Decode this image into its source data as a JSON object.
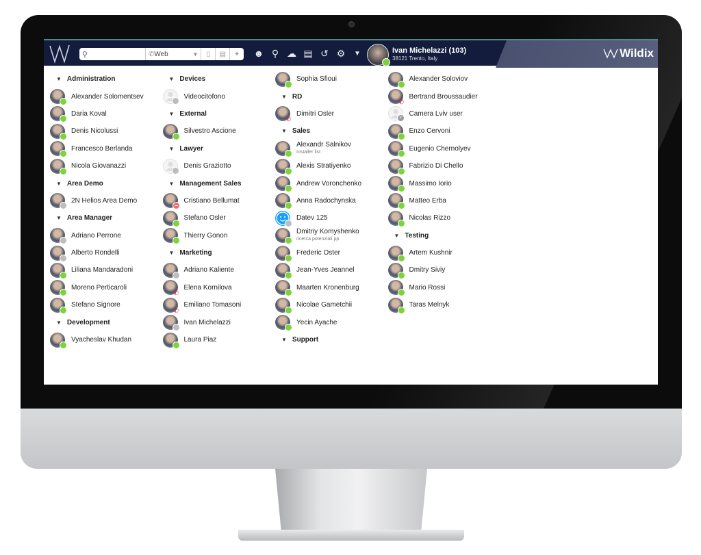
{
  "header": {
    "search_placeholder": "",
    "call_mode": "Web",
    "user_name": "Ivan Michelazzi (103)",
    "user_location": "38121 Trento, Italy",
    "user_status": "online",
    "brand": "Wildix",
    "toolbar_icons": [
      "users-icon",
      "location-pin-icon",
      "chat-icon",
      "phonebook-icon",
      "history-icon",
      "settings-icon",
      "chevron-down-icon"
    ]
  },
  "colors": {
    "header_bg": "#131c3d",
    "online": "#7ed23b",
    "offline": "#bdbdbd",
    "dnd": "#f06a6a",
    "call": "#e02020"
  },
  "columns": [
    [
      {
        "type": "group",
        "label": "Administration"
      },
      {
        "type": "contact",
        "label": "Alexander Solomentsev",
        "status": "online"
      },
      {
        "type": "contact",
        "label": "Daria Koval",
        "status": "online"
      },
      {
        "type": "contact",
        "label": "Denis Nicolussi",
        "status": "online"
      },
      {
        "type": "contact",
        "label": "Francesco Berlanda",
        "status": "online"
      },
      {
        "type": "contact",
        "label": "Nicola Giovanazzi",
        "status": "online"
      },
      {
        "type": "group",
        "label": "Area Demo"
      },
      {
        "type": "contact",
        "label": "2N Helios Area Demo",
        "status": "offline"
      },
      {
        "type": "group",
        "label": "Area Manager"
      },
      {
        "type": "contact",
        "label": "Adriano Perrone",
        "status": "offline"
      },
      {
        "type": "contact",
        "label": "Alberto Rondelli",
        "status": "offline"
      },
      {
        "type": "contact",
        "label": "Liliana Mandaradoni",
        "status": "online"
      },
      {
        "type": "contact",
        "label": "Moreno Perticaroli",
        "status": "online"
      },
      {
        "type": "contact",
        "label": "Stefano Signore",
        "status": "online"
      },
      {
        "type": "group",
        "label": "Development"
      },
      {
        "type": "contact",
        "label": "Vyacheslav Khudan",
        "status": "online"
      }
    ],
    [
      {
        "type": "group",
        "label": "Devices"
      },
      {
        "type": "contact",
        "label": "Videocitofono",
        "status": "offline",
        "avatar": "blank"
      },
      {
        "type": "group",
        "label": "External"
      },
      {
        "type": "contact",
        "label": "Silvestro Ascione",
        "status": "online"
      },
      {
        "type": "group",
        "label": "Lawyer"
      },
      {
        "type": "contact",
        "label": "Denis Graziotto",
        "status": "offline",
        "avatar": "blank"
      },
      {
        "type": "group",
        "label": "Management Sales"
      },
      {
        "type": "contact",
        "label": "Cristiano Bellumat",
        "status": "dnd"
      },
      {
        "type": "contact",
        "label": "Stefano Osler",
        "status": "online"
      },
      {
        "type": "contact",
        "label": "Thierry Gonon",
        "status": "online"
      },
      {
        "type": "group",
        "label": "Marketing"
      },
      {
        "type": "contact",
        "label": "Adriano Kaliente",
        "status": "offline"
      },
      {
        "type": "contact",
        "label": "Elena Kornilova",
        "status": "call"
      },
      {
        "type": "contact",
        "label": "Emiliano Tomasoni",
        "status": "call"
      },
      {
        "type": "contact",
        "label": "Ivan Michelazzi",
        "status": "offline"
      },
      {
        "type": "contact",
        "label": "Laura Piaz",
        "status": "online"
      }
    ],
    [
      {
        "type": "contact",
        "label": "Sophia Sfioui",
        "status": "online"
      },
      {
        "type": "group",
        "label": "RD"
      },
      {
        "type": "contact",
        "label": "Dimitri Osler",
        "status": "call"
      },
      {
        "type": "group",
        "label": "Sales"
      },
      {
        "type": "contact",
        "label": "Alexandr Salnikov",
        "sub": "Installer list",
        "status": "online"
      },
      {
        "type": "contact",
        "label": "Alexis Stratiyenko",
        "status": "online"
      },
      {
        "type": "contact",
        "label": "Andrew Voronchenko",
        "status": "online"
      },
      {
        "type": "contact",
        "label": "Anna Radochynska",
        "status": "online"
      },
      {
        "type": "contact",
        "label": "Datev 125",
        "status": "offline",
        "avatar": "smile"
      },
      {
        "type": "contact",
        "label": "Dmitriy Komyshenko",
        "sub": "ricerca potenziali pp",
        "status": "online"
      },
      {
        "type": "contact",
        "label": "Frederic Oster",
        "status": "online"
      },
      {
        "type": "contact",
        "label": "Jean-Yves Jeannel",
        "status": "online"
      },
      {
        "type": "contact",
        "label": "Maarten Kronenburg",
        "status": "online"
      },
      {
        "type": "contact",
        "label": "Nicolae Gametchii",
        "status": "online"
      },
      {
        "type": "contact",
        "label": "Yecin Ayache",
        "status": "online"
      },
      {
        "type": "group",
        "label": "Support"
      }
    ],
    [
      {
        "type": "contact",
        "label": "Alexander Soloviov",
        "status": "online"
      },
      {
        "type": "contact",
        "label": "Bertrand Broussaudier",
        "status": "call"
      },
      {
        "type": "contact",
        "label": "Camera Lviv user",
        "status": "unavailable",
        "avatar": "blank"
      },
      {
        "type": "contact",
        "label": "Enzo Cervoni",
        "status": "online"
      },
      {
        "type": "contact",
        "label": "Eugenio Chernolyev",
        "status": "online"
      },
      {
        "type": "contact",
        "label": "Fabrizio Di Chello",
        "status": "online"
      },
      {
        "type": "contact",
        "label": "Massimo Iorio",
        "status": "online"
      },
      {
        "type": "contact",
        "label": "Matteo Erba",
        "status": "online"
      },
      {
        "type": "contact",
        "label": "Nicolas Rizzo",
        "status": "online"
      },
      {
        "type": "group",
        "label": "Testing"
      },
      {
        "type": "contact",
        "label": "Artem Kushnir",
        "status": "online"
      },
      {
        "type": "contact",
        "label": "Dmitry Siviy",
        "status": "online"
      },
      {
        "type": "contact",
        "label": "Mario Rossi",
        "status": "online"
      },
      {
        "type": "contact",
        "label": "Taras Melnyk",
        "status": "online"
      }
    ]
  ]
}
